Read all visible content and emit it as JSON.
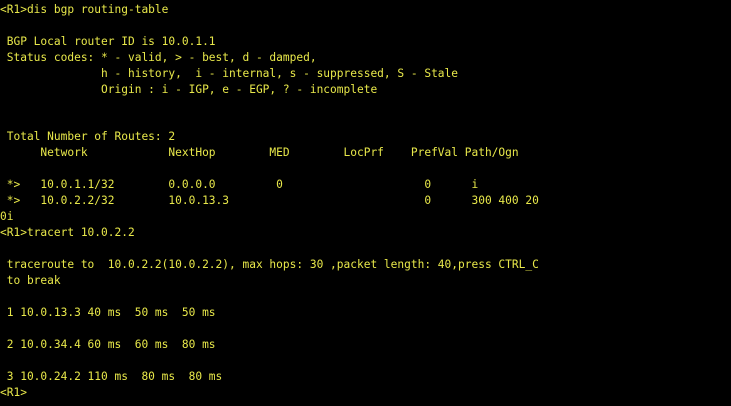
{
  "terminal": {
    "colors": {
      "background": "#000000",
      "text": "#e8e84a"
    },
    "lines": [
      {
        "text": "<R1>dis bgp routing-table"
      },
      {
        "text": ""
      },
      {
        "text": " BGP Local router ID is 10.0.1.1"
      },
      {
        "text": " Status codes: * - valid, > - best, d - damped,"
      },
      {
        "text": "               h - history,  i - internal, s - suppressed, S - Stale"
      },
      {
        "text": "               Origin : i - IGP, e - EGP, ? - incomplete"
      },
      {
        "text": ""
      },
      {
        "text": ""
      },
      {
        "text": " Total Number of Routes: 2"
      },
      {
        "text": "      Network            NextHop        MED        LocPrf    PrefVal Path/Ogn"
      },
      {
        "text": ""
      },
      {
        "text": " *>   10.0.1.1/32        0.0.0.0         0                     0      i"
      },
      {
        "text": " *>   10.0.2.2/32        10.0.13.3                             0      300 400 20"
      },
      {
        "text": "0i"
      },
      {
        "text": "<R1>tracert 10.0.2.2"
      },
      {
        "text": ""
      },
      {
        "text": " traceroute to  10.0.2.2(10.0.2.2), max hops: 30 ,packet length: 40,press CTRL_C"
      },
      {
        "text": " to break"
      },
      {
        "text": ""
      },
      {
        "text": " 1 10.0.13.3 40 ms  50 ms  50 ms"
      },
      {
        "text": ""
      },
      {
        "text": " 2 10.0.34.4 60 ms  60 ms  80 ms"
      },
      {
        "text": ""
      },
      {
        "text": " 3 10.0.24.2 110 ms  80 ms  80 ms"
      },
      {
        "text": "<R1>"
      }
    ]
  }
}
